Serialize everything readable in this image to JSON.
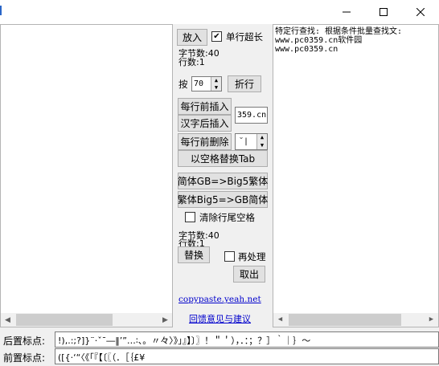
{
  "titlebar": {
    "minimize": "—",
    "maximize": "☐",
    "close": "✕"
  },
  "controls": {
    "zoom_button": "放入",
    "single_line_over_label": "单行超长",
    "single_line_over_checked": "✔",
    "byte_count_top": "字节数:40",
    "line_count_top": "行数:1",
    "by_label": "按",
    "wrap_width": "70",
    "wrap_button": "折行",
    "insert_before_line": "每行前插入",
    "insert_after_hanzi": "汉字后插入",
    "insert_text": "359.cn",
    "delete_before_line": "每行前删除",
    "delete_select": "˘|",
    "space_to_tab": "以空格替换Tab",
    "gb_to_big5": "简体GB=>Big5繁体",
    "big5_to_gb": "繁体Big5=>GB简体",
    "clear_trailing_label": "清除行尾空格",
    "byte_count_bottom": "字节数:40",
    "line_count_bottom": "行数:1",
    "replace_button": "替换",
    "reprocess_label": "再处理",
    "exit_button": "取出",
    "site_link": "copypaste.yeah.net",
    "feedback_link": "回馈意见与建议"
  },
  "right_pane": {
    "lines": [
      "特定行查找: 根据条件批量查找文:",
      "www.pc0359.cn软件园",
      "www.pc0359.cn"
    ]
  },
  "bottom": {
    "after_label": "后置标点:",
    "after_value": "!),.:;?]}¨·ˇˉ―‖’”…∶、。〃々〉》」』】〕〗！＂＇），．：；？］｀｜｝～",
    "before_label": "前置标点:",
    "before_value": "([{·‘“〈《「『【〔〖（．［｛£¥"
  }
}
